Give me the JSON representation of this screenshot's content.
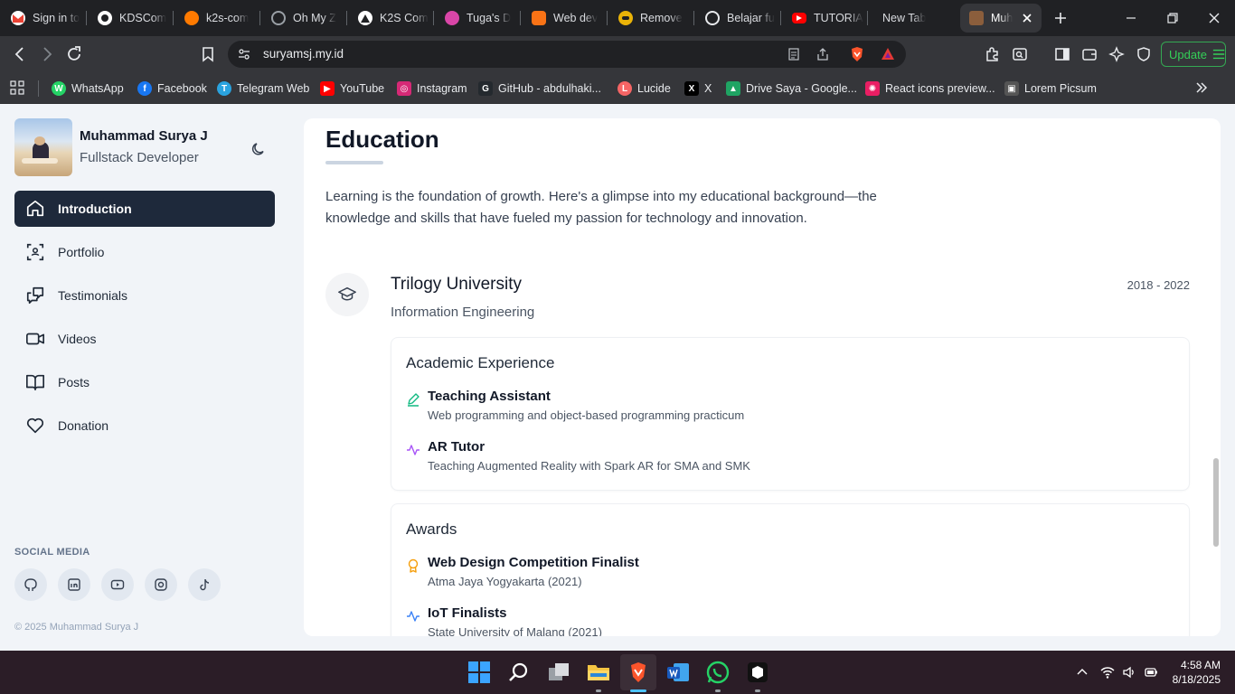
{
  "browser": {
    "tabs": [
      {
        "title": "Sign in to",
        "color": "#ea4335"
      },
      {
        "title": "KDSCom",
        "color": "#ffffff"
      },
      {
        "title": "k2s-com",
        "color": "#ff7a00"
      },
      {
        "title": "Oh My Z",
        "color": "#9aa0a6"
      },
      {
        "title": "K2S Com",
        "color": "#ffffff"
      },
      {
        "title": "Tuga's D",
        "color": "#d946a8"
      },
      {
        "title": "Web dev",
        "color": "#f97316"
      },
      {
        "title": "Remove",
        "color": "#eab308"
      },
      {
        "title": "Belajar fu",
        "color": "#e8eaed"
      },
      {
        "title": "TUTORIA",
        "color": "#ff0000"
      },
      {
        "title": "New Tab",
        "color": ""
      },
      {
        "title": "Muh",
        "color": "#8b5e3c"
      }
    ],
    "url": "suryamsj.my.id",
    "update_label": "Update",
    "bookmarks": [
      {
        "label": "WhatsApp",
        "color": "#25d366",
        "glyph": "W"
      },
      {
        "label": "Facebook",
        "color": "#1877f2",
        "glyph": "f"
      },
      {
        "label": "Telegram Web",
        "color": "#2aa3df",
        "glyph": "T"
      },
      {
        "label": "YouTube",
        "color": "#ff0000",
        "glyph": "▶"
      },
      {
        "label": "Instagram",
        "color": "#d62976",
        "glyph": "◎"
      },
      {
        "label": "GitHub - abdulhaki...",
        "color": "#24292e",
        "glyph": "G"
      },
      {
        "label": "Lucide",
        "color": "#f56565",
        "glyph": "L"
      },
      {
        "label": "X",
        "color": "#000000",
        "glyph": "X"
      },
      {
        "label": "Drive Saya - Google...",
        "color": "#1fa463",
        "glyph": "▲"
      },
      {
        "label": "React icons preview...",
        "color": "#e91e63",
        "glyph": "✺"
      },
      {
        "label": "Lorem Picsum",
        "color": "#555555",
        "glyph": "▣"
      }
    ]
  },
  "sidebar": {
    "name": "Muhammad Surya J",
    "role": "Fullstack Developer",
    "nav": [
      {
        "label": "Introduction",
        "icon": "home-icon",
        "active": true
      },
      {
        "label": "Portfolio",
        "icon": "scan-icon",
        "active": false
      },
      {
        "label": "Testimonials",
        "icon": "message-icon",
        "active": false
      },
      {
        "label": "Videos",
        "icon": "video-icon",
        "active": false
      },
      {
        "label": "Posts",
        "icon": "book-icon",
        "active": false
      },
      {
        "label": "Donation",
        "icon": "heart-icon",
        "active": false
      }
    ],
    "social_title": "SOCIAL MEDIA",
    "socials": [
      "github-icon",
      "linkedin-icon",
      "youtube-icon",
      "instagram-icon",
      "tiktok-icon"
    ],
    "copyright": "© 2025 Muhammad Surya J"
  },
  "main": {
    "title": "Education",
    "intro": "Learning is the foundation of growth. Here's a glimpse into my educational background—the knowledge and skills that have fueled my passion for technology and innovation.",
    "university": "Trilogy University",
    "years": "2018 - 2022",
    "major": "Information Engineering",
    "academic": {
      "title": "Academic Experience",
      "items": [
        {
          "title": "Teaching Assistant",
          "desc": "Web programming and object-based programming practicum",
          "color": "#10b981"
        },
        {
          "title": "AR Tutor",
          "desc": "Teaching Augmented Reality with Spark AR for SMA and SMK",
          "color": "#a855f7"
        }
      ]
    },
    "awards": {
      "title": "Awards",
      "items": [
        {
          "title": "Web Design Competition Finalist",
          "desc": "Atma Jaya Yogyakarta (2021)",
          "color": "#f59e0b"
        },
        {
          "title": "IoT Finalists",
          "desc": "State University of Malang (2021)",
          "color": "#3b82f6"
        }
      ]
    }
  },
  "taskbar": {
    "time": "4:58 AM",
    "date": "8/18/2025"
  }
}
